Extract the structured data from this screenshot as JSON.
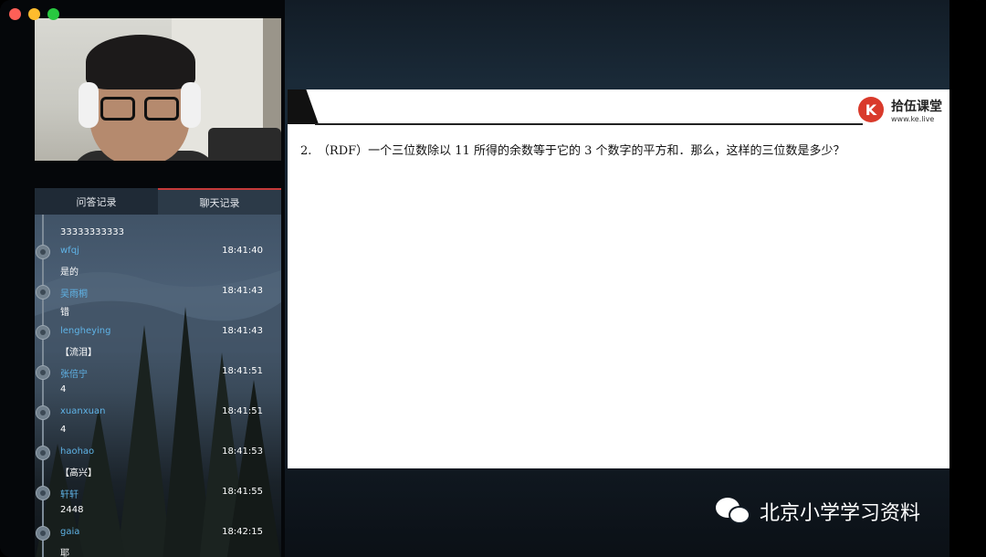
{
  "chat": {
    "tabs": [
      "问答记录",
      "聊天记录"
    ],
    "first_message": "33333333333",
    "messages": [
      {
        "name": "wfqj",
        "time": "18:41:40",
        "text": "是的"
      },
      {
        "name": "吴雨桐",
        "time": "18:41:43",
        "text": "错"
      },
      {
        "name": "lengheying",
        "time": "18:41:43",
        "text": "【流泪】"
      },
      {
        "name": "张倍宁",
        "time": "18:41:51",
        "text": "4"
      },
      {
        "name": "xuanxuan",
        "time": "18:41:51",
        "text": "4"
      },
      {
        "name": "haohao",
        "time": "18:41:53",
        "text": "【高兴】"
      },
      {
        "name": "轩轩",
        "time": "18:41:55",
        "text": "2448"
      },
      {
        "name": "gaia",
        "time": "18:42:15",
        "text": "耶"
      }
    ]
  },
  "slide": {
    "logo_mark": "K",
    "logo_brand": "拾伍课堂",
    "logo_url": "www.ke.live",
    "question": "2.　（RDF）一个三位数除以 11 所得的余数等于它的 3 个数字的平方和．那么，这样的三位数是多少？"
  },
  "watermark": {
    "icon": "wechat-icon",
    "text": "北京小学学习资料"
  },
  "colors": {
    "accent_tab": "#c53a3a",
    "chat_name": "#5fb3e6",
    "logo_red": "#d93a2b"
  }
}
